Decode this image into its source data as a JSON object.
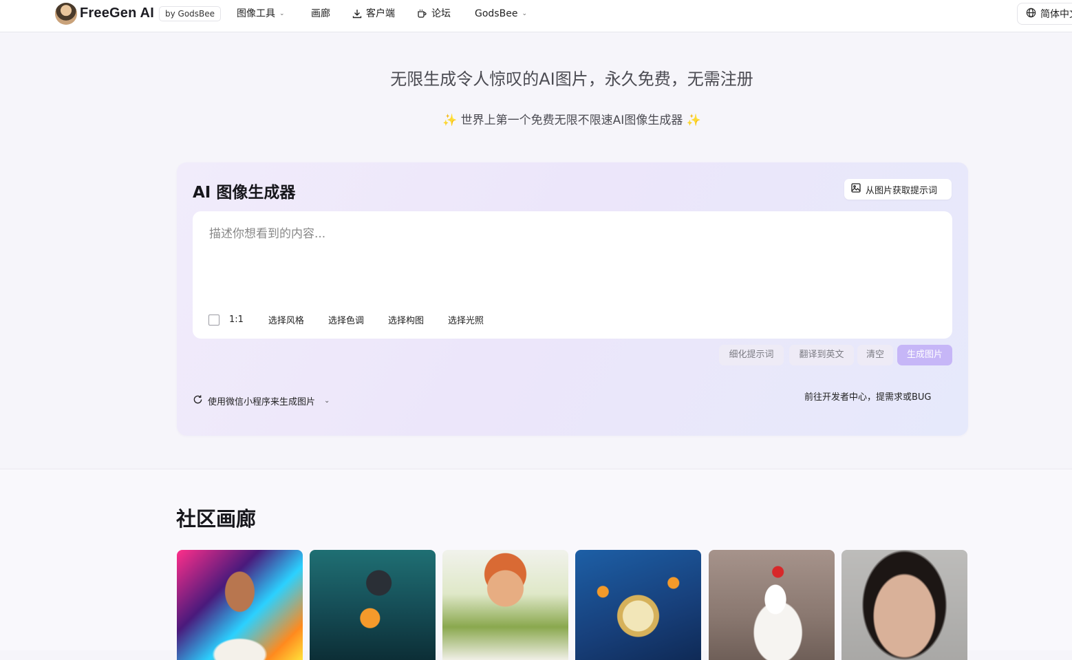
{
  "header": {
    "brand": "FreeGen AI",
    "badge": "by GodsBee",
    "nav": {
      "image_tools": "图像工具",
      "gallery": "画廊",
      "client": "客户端",
      "forum": "论坛",
      "godsbee": "GodsBee"
    },
    "language": "简体中文"
  },
  "hero": {
    "title": "无限生成令人惊叹的AI图片，永久免费，无需注册",
    "subtitle": "世界上第一个免费无限不限速AI图像生成器"
  },
  "generator": {
    "title": "AI 图像生成器",
    "image_prompt_button": "从图片获取提示词",
    "placeholder": "描述你想看到的内容...",
    "ratio": "1:1",
    "options": {
      "style": "选择风格",
      "tone": "选择色调",
      "composition": "选择构图",
      "lighting": "选择光照"
    },
    "actions": {
      "refine": "细化提示词",
      "translate": "翻译到英文",
      "clear": "清空",
      "generate": "生成图片"
    },
    "wechat_link": "使用微信小程序来生成图片",
    "dev_link": "前往开发者中心，提需求或BUG"
  },
  "gallery": {
    "title": "社区画廊"
  },
  "colors": {
    "accent_button": "#c6b6f7",
    "card_gradient_start": "#f1ecfb",
    "card_gradient_end": "#e6e9fb",
    "sparkle": "#f0b81e"
  }
}
